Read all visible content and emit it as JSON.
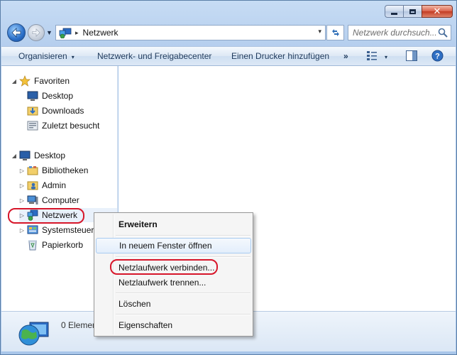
{
  "window": {
    "title_buttons": {
      "minimize": "minimize",
      "maximize": "maximize",
      "close": "✕"
    }
  },
  "address": {
    "path": "Netzwerk",
    "separator": "▸",
    "dropdown_glyph": "▾"
  },
  "search": {
    "placeholder": "Netzwerk durchsuch..."
  },
  "toolbar": {
    "organize": "Organisieren",
    "network_center": "Netzwerk- und Freigabecenter",
    "add_printer": "Einen Drucker hinzufügen",
    "more": "»",
    "caret": "▾"
  },
  "navigation": {
    "favorites": {
      "label": "Favoriten",
      "items": [
        "Desktop",
        "Downloads",
        "Zuletzt besucht"
      ]
    },
    "desktop": {
      "label": "Desktop",
      "items": [
        "Bibliotheken",
        "Admin",
        "Computer",
        "Netzwerk",
        "Systemsteuerung",
        "Papierkorb"
      ]
    }
  },
  "details": {
    "status": "0 Elemente"
  },
  "context_menu": {
    "items": [
      "Erweitern",
      "In neuem Fenster öffnen",
      "Netzlaufwerk verbinden...",
      "Netzlaufwerk trennen...",
      "Löschen",
      "Eigenschaften"
    ]
  },
  "icons": {
    "back": "back-arrow-icon",
    "forward": "forward-arrow-icon",
    "network": "network-globe-icon",
    "refresh": "refresh-icon",
    "search": "magnifier-icon",
    "view": "view-options-icon",
    "preview": "preview-pane-icon",
    "help": "help-icon"
  },
  "colors": {
    "highlight": "#d7162a",
    "accent": "#1e395b"
  }
}
